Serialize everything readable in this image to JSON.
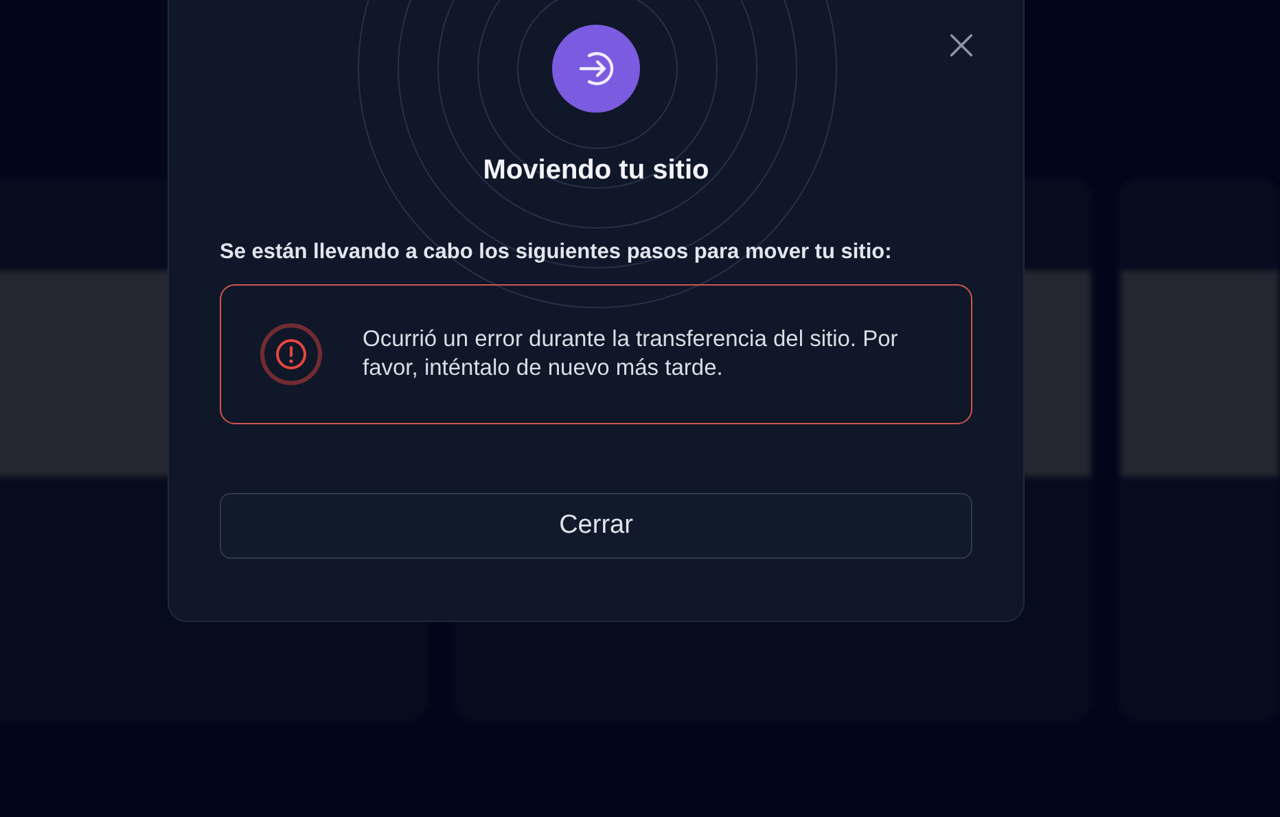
{
  "dialog": {
    "title": "Moviendo tu sitio",
    "subtitle": "Se están llevando a cabo los siguientes pasos para mover tu sitio:",
    "alert": {
      "kind": "error",
      "message": "Ocurrió un error durante la transferencia del sitio. Por favor, inténtalo de nuevo más tarde."
    },
    "buttons": [
      "Cerrar"
    ]
  }
}
